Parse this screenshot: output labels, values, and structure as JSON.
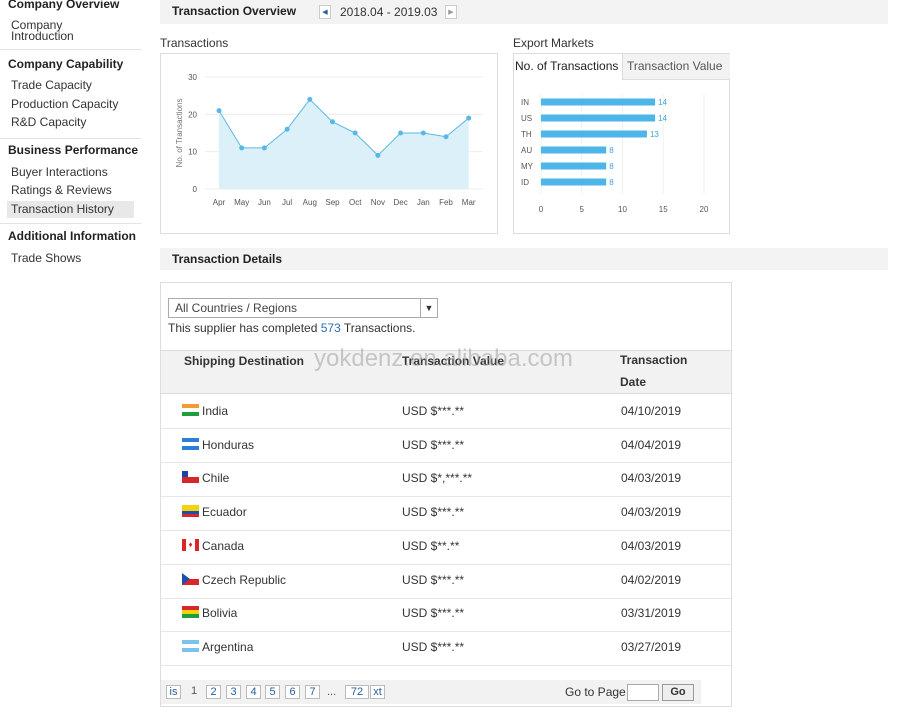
{
  "sidebar": {
    "sections": [
      {
        "title": "Company Overview",
        "items": [
          "Company Introduction"
        ]
      },
      {
        "title": "Company Capability",
        "items": [
          "Trade Capacity",
          "Production Capacity",
          "R&D Capacity"
        ]
      },
      {
        "title": "Business Performance",
        "items": [
          "Buyer Interactions",
          "Ratings & Reviews",
          "Transaction History"
        ]
      },
      {
        "title": "Additional Information",
        "items": [
          "Trade Shows"
        ]
      }
    ],
    "company_intro_line1": "Company",
    "company_intro_line2": "Introduction",
    "active_item": "Transaction History"
  },
  "overview": {
    "title": "Transaction Overview",
    "date_range": "2018.04 - 2019.03",
    "prev_icon": "triangle-left-icon",
    "next_icon": "triangle-right-icon"
  },
  "transactions_chart_title": "Transactions",
  "export_title": "Export Markets",
  "export_tabs": [
    "No. of Transactions",
    "Transaction Value"
  ],
  "chart_data": [
    {
      "type": "area",
      "title": "Transactions",
      "ylabel": "No. of Transactions",
      "xlabel": "",
      "categories": [
        "Apr",
        "May",
        "Jun",
        "Jul",
        "Aug",
        "Sep",
        "Oct",
        "Nov",
        "Dec",
        "Jan",
        "Feb",
        "Mar"
      ],
      "values": [
        21,
        11,
        11,
        16,
        24,
        18,
        15,
        9,
        15,
        15,
        14,
        19
      ],
      "ylim": [
        0,
        30
      ],
      "yticks": [
        0,
        10,
        20,
        30
      ],
      "color": "#5bb8e6",
      "fill": "#dcf0fa",
      "grid": true
    },
    {
      "type": "bar",
      "orientation": "horizontal",
      "title": "Export Markets",
      "categories": [
        "IN",
        "US",
        "TH",
        "AU",
        "MY",
        "ID"
      ],
      "values": [
        14,
        14,
        13,
        8,
        8,
        8
      ],
      "xlim": [
        0,
        20
      ],
      "xticks": [
        0,
        5,
        10,
        15,
        20
      ],
      "color": "#4db6e8",
      "label_color": "#3aa4d8"
    }
  ],
  "details": {
    "title": "Transaction Details",
    "filter_value": "All Countries / Regions",
    "summary_prefix": "This supplier has completed ",
    "summary_count": "573",
    "summary_suffix": " Transactions.",
    "columns": [
      "Shipping Destination",
      "Transaction Value",
      "Transaction Date"
    ],
    "rows": [
      {
        "country": "India",
        "value": "USD $***.**",
        "date": "04/10/2019",
        "flag": "india-flag-icon"
      },
      {
        "country": "Honduras",
        "value": "USD $***.**",
        "date": "04/04/2019",
        "flag": "honduras-flag-icon"
      },
      {
        "country": "Chile",
        "value": "USD $*,***.**",
        "date": "04/03/2019",
        "flag": "chile-flag-icon"
      },
      {
        "country": "Ecuador",
        "value": "USD $***.**",
        "date": "04/03/2019",
        "flag": "ecuador-flag-icon"
      },
      {
        "country": "Canada",
        "value": "USD $**.**",
        "date": "04/03/2019",
        "flag": "canada-flag-icon"
      },
      {
        "country": "Czech Republic",
        "value": "USD $***.**",
        "date": "04/02/2019",
        "flag": "czech-flag-icon"
      },
      {
        "country": "Bolivia",
        "value": "USD $***.**",
        "date": "03/31/2019",
        "flag": "bolivia-flag-icon"
      },
      {
        "country": "Argentina",
        "value": "USD $***.**",
        "date": "03/27/2019",
        "flag": "argentina-flag-icon"
      }
    ]
  },
  "pagination": {
    "prev": "is",
    "current": "1",
    "pages": [
      "2",
      "3",
      "4",
      "5",
      "6",
      "7"
    ],
    "ellipsis": "...",
    "last": "72",
    "next": "xt",
    "goto_label": "Go to Page",
    "go_button": "Go"
  },
  "watermark": "yokdenz.en.alibaba.com"
}
